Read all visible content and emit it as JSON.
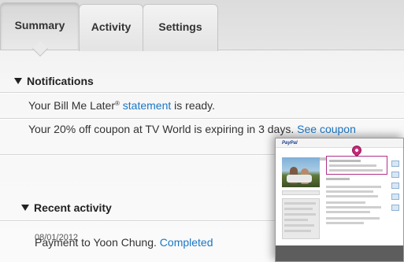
{
  "tabs": [
    {
      "label": "Summary",
      "active": true
    },
    {
      "label": "Activity",
      "active": false
    },
    {
      "label": "Settings",
      "active": false
    }
  ],
  "notifications": {
    "heading": "Notifications",
    "items": [
      {
        "text_before": "Your Bill Me Later",
        "superscript": "®",
        "link": "statement",
        "text_after": " is ready."
      },
      {
        "text_before": "Your 20% off coupon at TV World is expiring in 3 days.",
        "link": "See coupon"
      }
    ]
  },
  "recent_activity": {
    "heading": "Recent activity",
    "items": [
      {
        "date": "08/01/2012",
        "text": "Payment to Yoon Chung.",
        "status": "Completed"
      }
    ]
  },
  "thumbnail": {
    "logo": "PayPal",
    "highlight_color": "#b0308a"
  },
  "colors": {
    "link": "#1a76c6",
    "tab_bg": "#e3e3e3"
  }
}
